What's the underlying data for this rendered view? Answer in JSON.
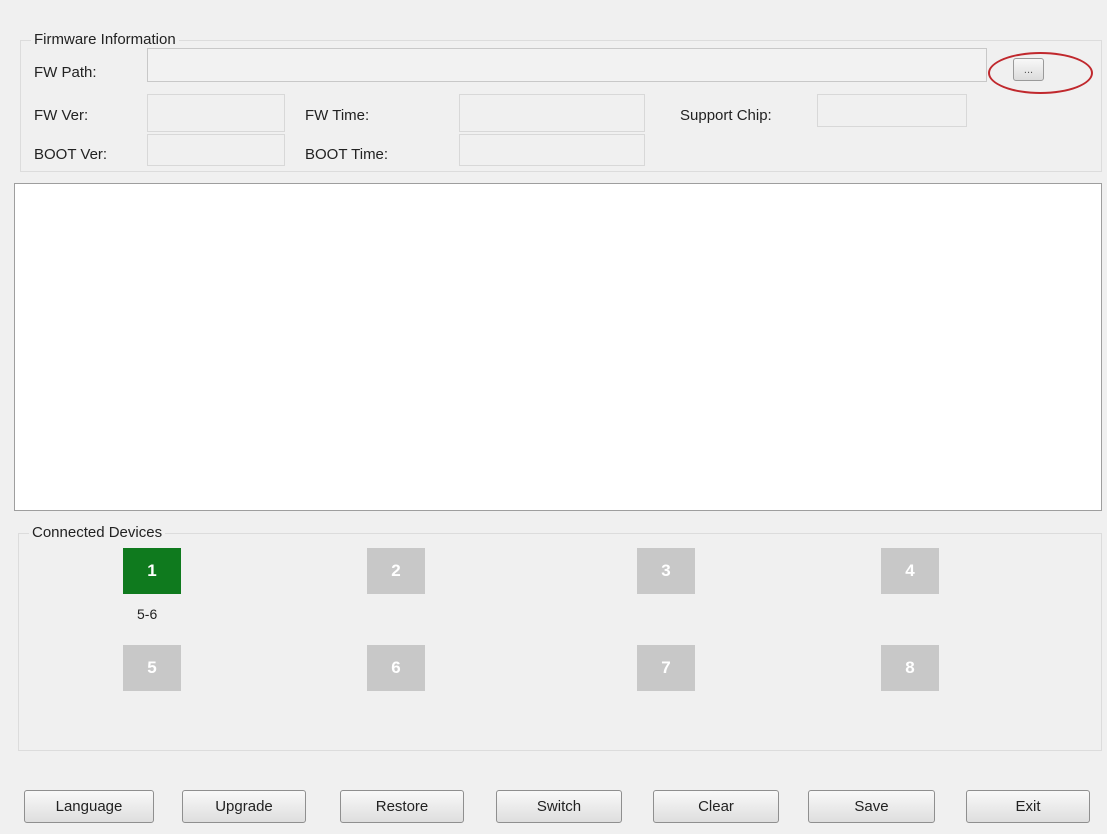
{
  "firmware": {
    "title": "Firmware Information",
    "path_label": "FW Path:",
    "path_value": "",
    "browse_label": "...",
    "fw_ver_label": "FW Ver:",
    "fw_ver_value": "",
    "fw_time_label": "FW Time:",
    "fw_time_value": "",
    "support_chip_label": "Support Chip:",
    "support_chip_value": "",
    "boot_ver_label": "BOOT Ver:",
    "boot_ver_value": "",
    "boot_time_label": "BOOT Time:",
    "boot_time_value": ""
  },
  "log": {
    "text": ""
  },
  "devices": {
    "title": "Connected Devices",
    "tiles": [
      {
        "label": "1",
        "active": true,
        "sub": "5-6"
      },
      {
        "label": "2",
        "active": false
      },
      {
        "label": "3",
        "active": false
      },
      {
        "label": "4",
        "active": false
      },
      {
        "label": "5",
        "active": false
      },
      {
        "label": "6",
        "active": false
      },
      {
        "label": "7",
        "active": false
      },
      {
        "label": "8",
        "active": false
      }
    ]
  },
  "buttons": {
    "language": "Language",
    "upgrade": "Upgrade",
    "restore": "Restore",
    "switch": "Switch",
    "clear": "Clear",
    "save": "Save",
    "exit": "Exit"
  },
  "colors": {
    "active_device": "#0f7a1e",
    "inactive_device": "#c8c8c8",
    "highlight": "#c0282d"
  }
}
